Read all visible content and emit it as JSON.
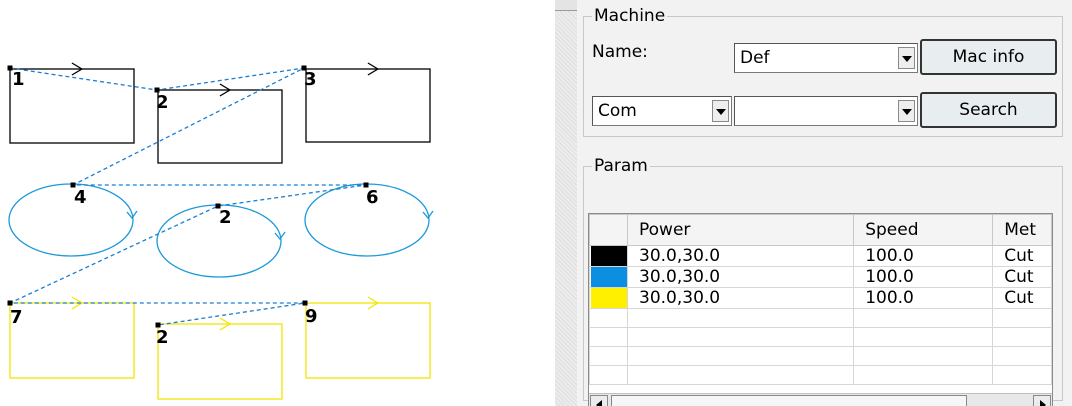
{
  "canvas": {
    "shapes": [
      {
        "kind": "rect",
        "color": "#000000",
        "arrow": "right"
      },
      {
        "kind": "rect",
        "color": "#000000",
        "arrow": "right"
      },
      {
        "kind": "rect",
        "color": "#000000",
        "arrow": "right"
      },
      {
        "kind": "ellipse",
        "color": "#1a9ad9",
        "arrow": "down"
      },
      {
        "kind": "ellipse",
        "color": "#1a9ad9",
        "arrow": "down"
      },
      {
        "kind": "ellipse",
        "color": "#1a9ad9",
        "arrow": "down"
      },
      {
        "kind": "rect",
        "color": "#f2e600",
        "arrow": "right"
      },
      {
        "kind": "rect",
        "color": "#f2e600",
        "arrow": "right"
      },
      {
        "kind": "rect",
        "color": "#f2e600",
        "arrow": "right"
      }
    ],
    "start_labels": [
      "1",
      "2",
      "3",
      "4",
      "2",
      "6",
      "7",
      "2",
      "9"
    ],
    "path_color": "#1a7fd4",
    "path_style": "dashed"
  },
  "machine": {
    "legend": "Machine",
    "name_label": "Name:",
    "name_value": "Def",
    "mac_info_label": "Mac info",
    "port_value": "Com",
    "port2_value": "",
    "search_label": "Search"
  },
  "param": {
    "legend": "Param",
    "columns": [
      "",
      "Power",
      "Speed",
      "Met"
    ],
    "rows": [
      {
        "color": "#000000",
        "power": "30.0,30.0",
        "speed": "100.0",
        "method": "Cut"
      },
      {
        "color": "#0c8fe0",
        "power": "30.0,30.0",
        "speed": "100.0",
        "method": "Cut"
      },
      {
        "color": "#fff000",
        "power": "30.0,30.0",
        "speed": "100.0",
        "method": "Cut"
      }
    ],
    "empty_rows": 4
  }
}
